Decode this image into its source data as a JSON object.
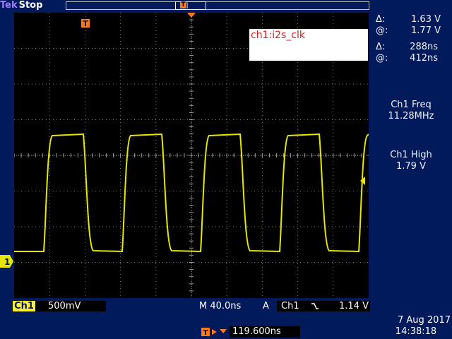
{
  "header": {
    "brand": "Tek",
    "run_state": "Stop",
    "trigger_position_marker": "T"
  },
  "waveform": {
    "label": "ch1:i2s_clk",
    "channel_marker": "1",
    "trigger_marker": "T",
    "signal_color": "#e6e600",
    "high_level_v": 1.79,
    "low_level_v": 0.0
  },
  "cursors": {
    "delta_v_symbol": "Δ:",
    "delta_v": "1.63 V",
    "at_v_symbol": "@:",
    "at_v": "1.77 V",
    "delta_t_symbol": "Δ:",
    "delta_t": "288ns",
    "at_t_symbol": "@:",
    "at_t": "412ns"
  },
  "measurements": [
    {
      "label": "Ch1 Freq",
      "value": "11.28MHz"
    },
    {
      "label": "Ch1 High",
      "value": "1.79 V"
    }
  ],
  "footer": {
    "channel_badge": "Ch1",
    "volts_per_div": "500mV",
    "timebase": "M 40.0ns",
    "trigger_source_prefix": "A",
    "trigger_channel": "Ch1",
    "trigger_slope_icon": "falling-edge-icon",
    "trigger_level": "1.14 V",
    "position_icon": "T→",
    "horizontal_position": "119.600ns",
    "date": "7 Aug 2017",
    "time": "14:38:18"
  },
  "colors": {
    "background": "#001a5c",
    "plot_background": "#000000",
    "trace": "#e6e600",
    "marker_orange": "#ff7a1a",
    "grid": "#808080"
  }
}
